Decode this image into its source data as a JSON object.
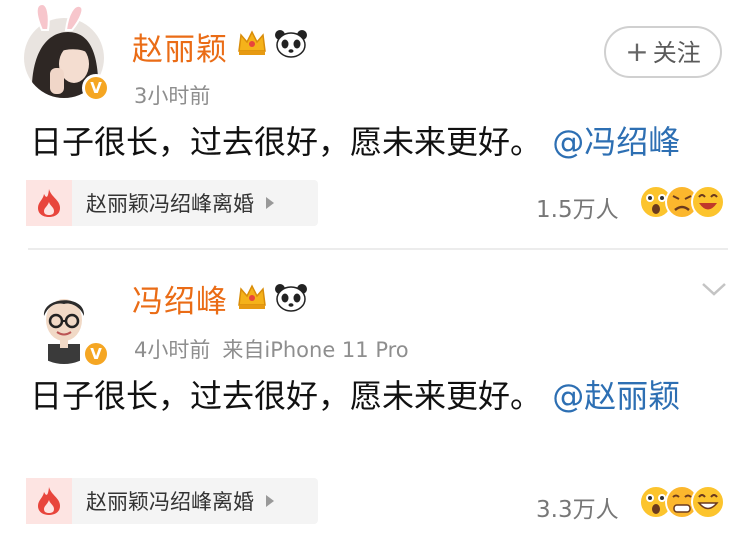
{
  "posts": [
    {
      "author": "赵丽颖",
      "time": "3小时前",
      "source": "",
      "follow_label": "关注",
      "text": "日子很长，过去很好，愿未来更好。",
      "mention": "@冯绍峰",
      "topic": "赵丽颖冯绍峰离婚",
      "reactions_count": "1.5万人"
    },
    {
      "author": "冯绍峰",
      "time": "4小时前",
      "source": "来自iPhone 11 Pro",
      "text": "日子很长，过去很好，愿未来更好。",
      "mention": "@赵丽颖",
      "topic": "赵丽颖冯绍峰离婚",
      "reactions_count": "3.3万人"
    }
  ],
  "icons": {
    "verified": "verified-badge-icon",
    "crown": "crown-icon",
    "panda": "panda-icon",
    "hot": "hot-topic-icon",
    "more": "chevron-down-icon"
  },
  "colors": {
    "author_name": "#ea6c16",
    "mention": "#2d6fb3",
    "verified_badge": "#f5a623",
    "hot_icon": "#e8453c"
  }
}
